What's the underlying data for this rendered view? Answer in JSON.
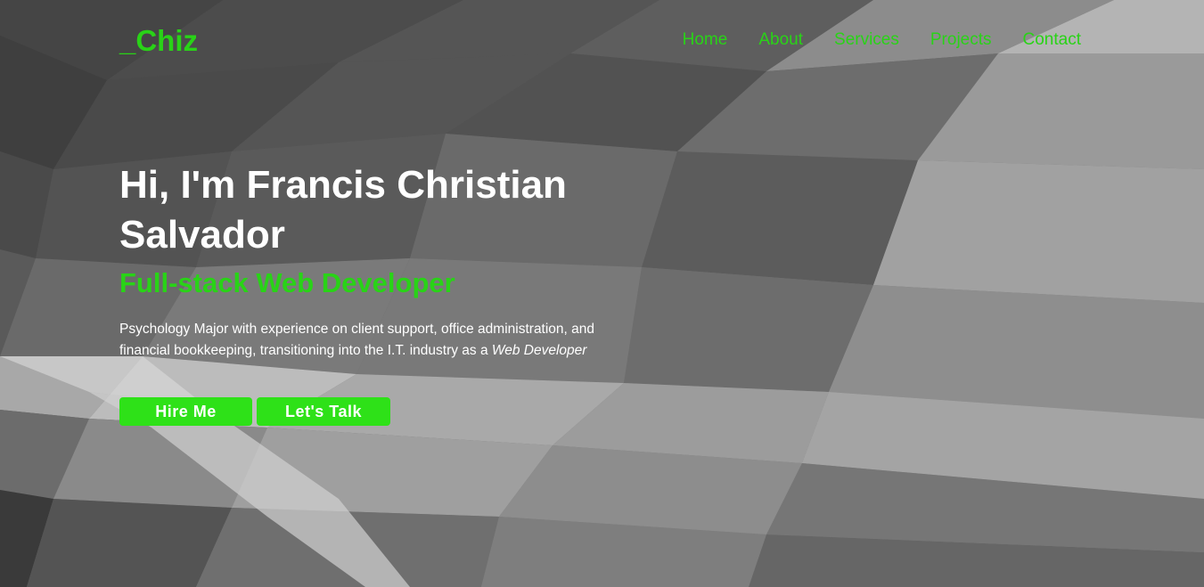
{
  "logo": "_Chiz",
  "nav": {
    "items": [
      "Home",
      "About",
      "Services",
      "Projects",
      "Contact"
    ]
  },
  "hero": {
    "headline": "Hi, I'm Francis Christian Salvador",
    "subtitle": "Full-stack Web Developer",
    "description_text": "Psychology Major with experience on client support, office administration, and financial bookkeeping, transitioning into the I.T. industry as a ",
    "description_emphasis": "Web Developer",
    "buttons": {
      "hire": "Hire Me",
      "talk": "Let's Talk"
    }
  },
  "colors": {
    "accent": "#29d317",
    "button": "#2ee118",
    "text": "#ffffff",
    "background": "#6a6a6a"
  }
}
